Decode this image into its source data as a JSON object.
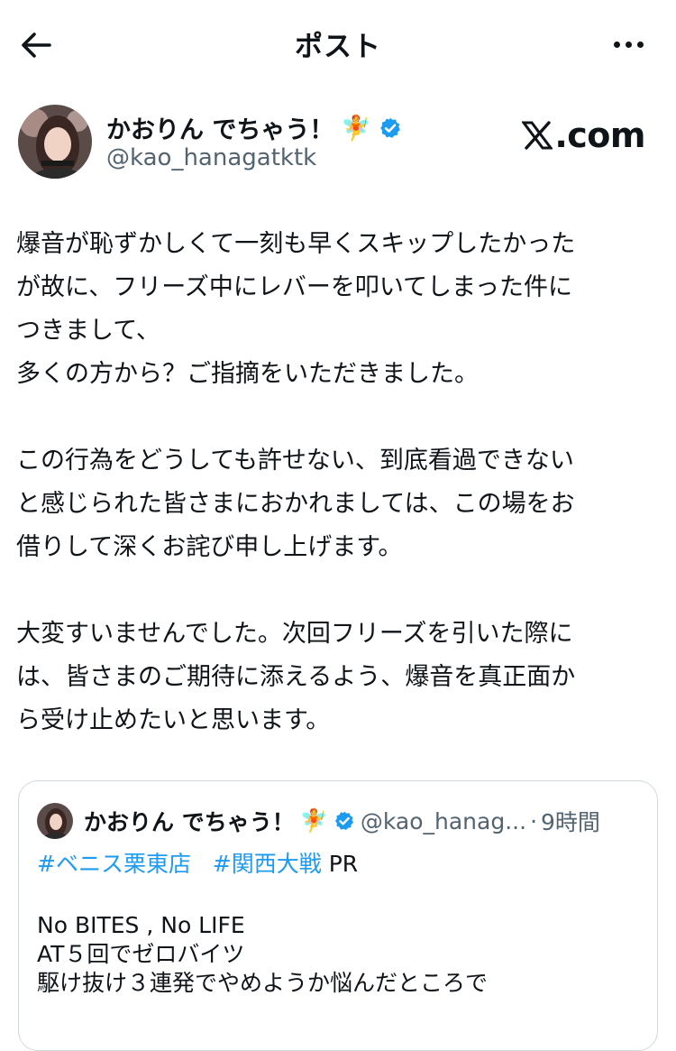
{
  "header": {
    "title": "ポスト"
  },
  "author": {
    "display_name": "かおりん でちゃう！",
    "name_emoji": "🧚",
    "handle": "@kao_hanagatktk",
    "verified": true,
    "brand_text": ".com"
  },
  "post": {
    "paragraphs": [
      [
        "爆音が恥ずかしくて一刻も早くスキップしたかった",
        "が故に、フリーズ中にレバーを叩いてしまった件に",
        "つきまして、",
        "多くの方から？ご指摘をいただきました。"
      ],
      [
        "この行為をどうしても許せない、到底看過できない",
        "と感じられた皆さまにおかれましては、この場をお",
        "借りして深くお詫び申し上げます。"
      ],
      [
        "大変すいませんでした。次回フリーズを引いた際に",
        "は、皆さまのご期待に添えるよう、爆音を真正面か",
        "ら受け止めたいと思います。"
      ]
    ]
  },
  "quote": {
    "display_name": "かおりん でちゃう！",
    "name_emoji": "🧚",
    "handle": "@kao_hanag...",
    "separator": "·",
    "time": "9時間",
    "hashtags": [
      "#ベニス栗東店",
      "#関西大戦"
    ],
    "tag_suffix": "PR",
    "lines": [
      "No BITES , No LIFE",
      "AT５回でゼロバイツ",
      "駆け抜け３連発でやめようか悩んだところで"
    ]
  },
  "colors": {
    "accent": "#1d9bf0",
    "text": "#0f1419",
    "secondary": "#536471",
    "border": "#cfd9de"
  }
}
